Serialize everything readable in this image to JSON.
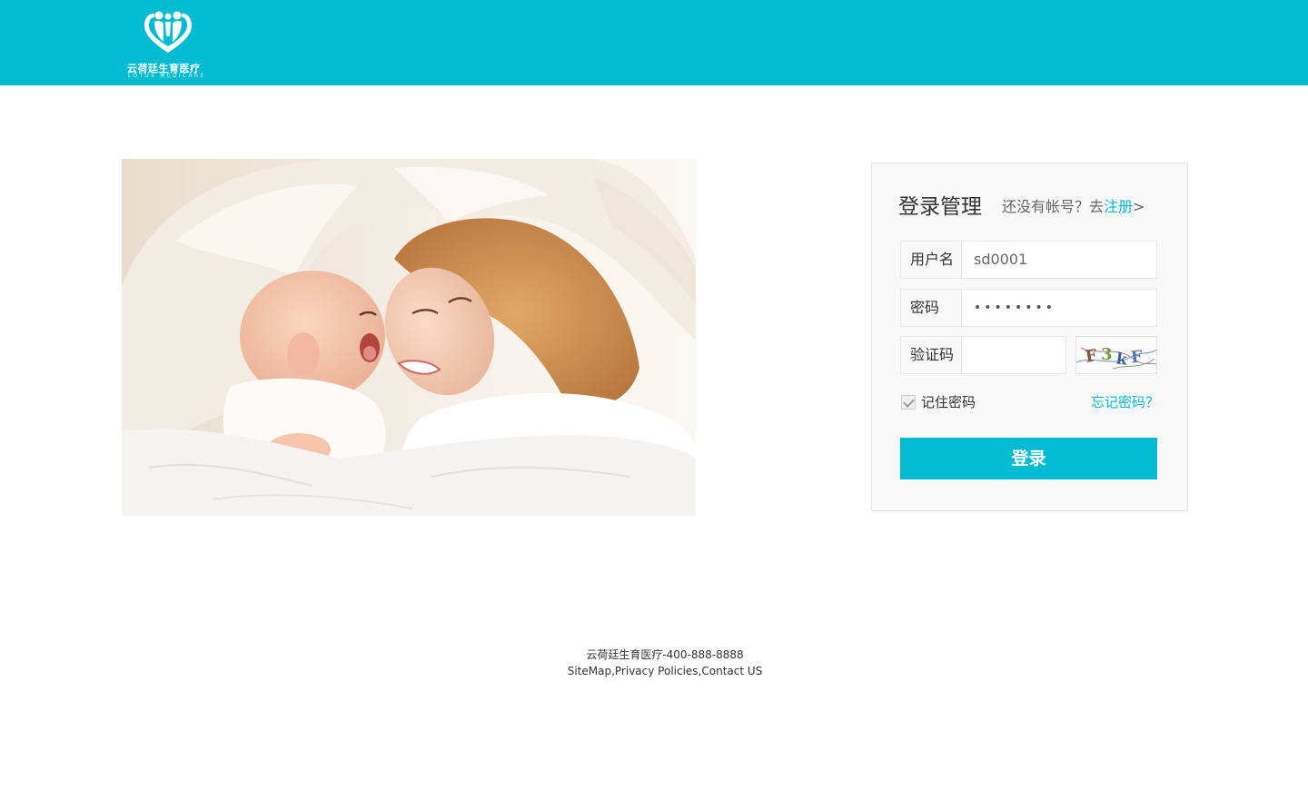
{
  "header": {
    "logo_cn": "云荷廷生育医疗",
    "logo_en": "LOTUS MEDICARE",
    "bg_color": "#03bcd1"
  },
  "hero": {
    "icon": "mother-and-baby-photo"
  },
  "login": {
    "title": "登录管理",
    "register_prompt": "还没有帐号？去",
    "register_link": "注册",
    "register_arrow": ">",
    "username_label": "用户名",
    "username_value": "sd0001",
    "password_label": "密码",
    "password_value": "••••••••",
    "code_label": "验证码",
    "code_value": "",
    "captcha_text": "F3kF",
    "remember_label": "记住密码",
    "remember_checked": true,
    "forgot_link": "忘记密码？",
    "login_button": "登录",
    "accent_color": "#03bcd1"
  },
  "footer": {
    "line1": "云荷廷生育医疗-400-888-8888",
    "sitemap": "SiteMap",
    "privacy": "Privacy Policies",
    "contact": "Contact US"
  }
}
